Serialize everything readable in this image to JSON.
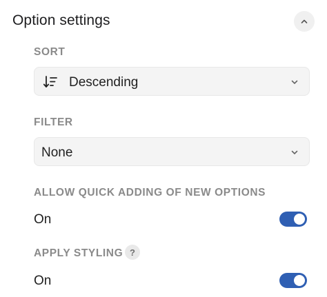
{
  "header": {
    "title": "Option settings",
    "collapse_icon": "chevron-up-icon"
  },
  "sort": {
    "label": "SORT",
    "value": "Descending",
    "icon": "sort-descending-icon",
    "chevron_icon": "chevron-down-icon"
  },
  "filter": {
    "label": "FILTER",
    "value": "None",
    "chevron_icon": "chevron-down-icon"
  },
  "quick_add": {
    "label": "ALLOW QUICK ADDING OF NEW OPTIONS",
    "state_text": "On",
    "enabled": true
  },
  "styling": {
    "label": "APPLY STYLING",
    "help_text": "?",
    "state_text": "On",
    "enabled": true
  },
  "colors": {
    "toggle_on": "#2f5fb3",
    "label_gray": "#8a8a8a",
    "field_bg": "#f4f4f4"
  }
}
